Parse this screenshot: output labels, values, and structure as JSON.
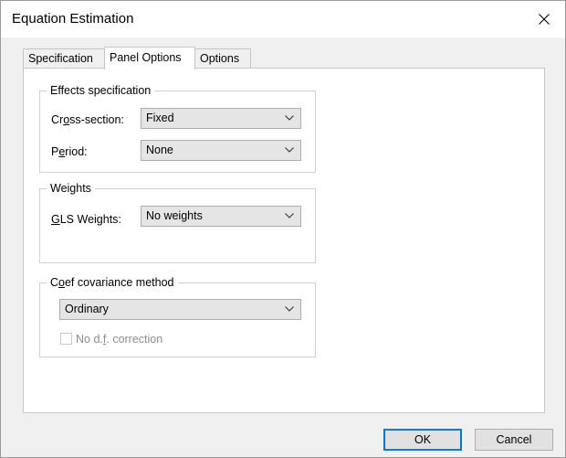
{
  "window": {
    "title": "Equation Estimation",
    "close_glyph": "close-icon"
  },
  "tabs": [
    {
      "label": "Specification",
      "active": false
    },
    {
      "label": "Panel Options",
      "active": true
    },
    {
      "label": "Options",
      "active": false
    }
  ],
  "effects": {
    "group_title": "Effects specification",
    "cross_section": {
      "label_pre": "Cr",
      "label_ul": "o",
      "label_post": "ss-section:",
      "value": "Fixed"
    },
    "period": {
      "label_pre": "P",
      "label_ul": "e",
      "label_post": "riod:",
      "value": "None"
    }
  },
  "weights": {
    "group_title": "Weights",
    "gls": {
      "label_pre": "",
      "label_ul": "G",
      "label_post": "LS Weights:",
      "value": "No weights"
    }
  },
  "coef": {
    "group_title_pre": "C",
    "group_title_ul": "o",
    "group_title_post": "ef covariance method",
    "method_value": "Ordinary",
    "df_label_pre": "No d.",
    "df_label_ul": "f",
    "df_label_post": ". correction",
    "df_checked": false,
    "df_enabled": false
  },
  "footer": {
    "ok_label": "OK",
    "cancel_label": "Cancel"
  },
  "colors": {
    "accent": "#0078d7",
    "dialog_bg": "#f0f0f0",
    "combo_bg": "#e5e5e5",
    "disabled_text": "#8d8d8d"
  }
}
